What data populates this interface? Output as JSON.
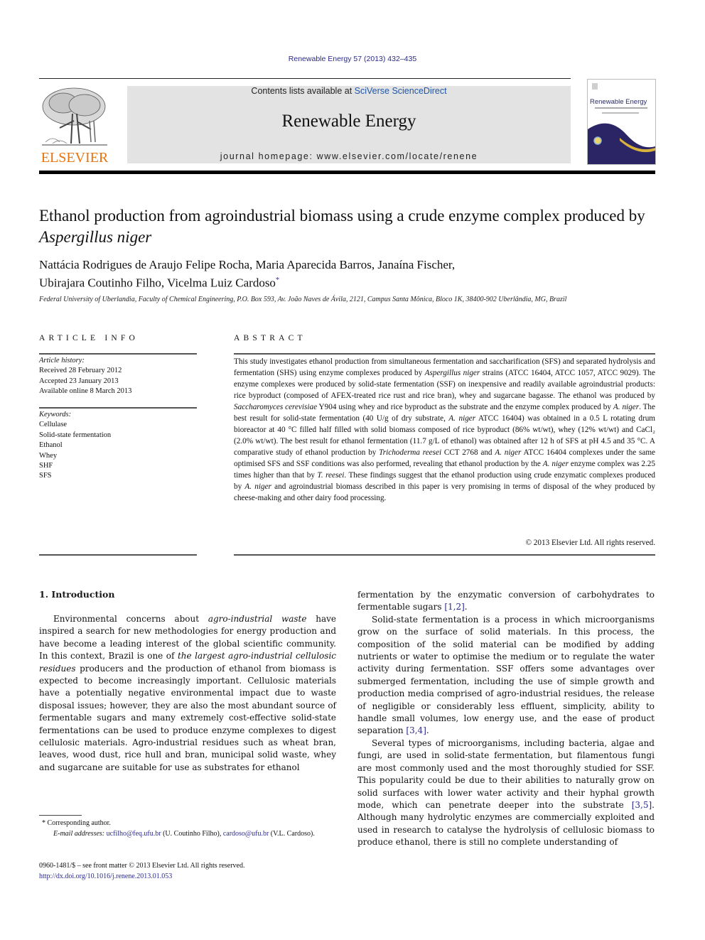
{
  "header": {
    "citation": "Renewable Energy 57 (2013) 432–435",
    "contents_prefix": "Contents lists available at ",
    "contents_link": "SciVerse ScienceDirect",
    "journal_name": "Renewable Energy",
    "homepage_prefix": "journal homepage: ",
    "homepage_url": "www.elsevier.com/locate/renene",
    "publisher_logo": "ELSEVIER",
    "cover_title": "Renewable Energy",
    "colors": {
      "link": "#2a2a8c",
      "elsevier_orange": "#e8730e",
      "masthead_gray": "#e3e3e3",
      "cover_navy": "#2b2566",
      "cover_gold": "#d8b23a"
    }
  },
  "article": {
    "title_plain": "Ethanol production from agroindustrial biomass using a crude enzyme complex produced by ",
    "title_italic": "Aspergillus niger",
    "authors_line1": "Nattácia Rodrigues de Araujo Felipe Rocha, Maria Aparecida Barros, Janaína Fischer,",
    "authors_line2": "Ubirajara Coutinho Filho, Vicelma Luiz Cardoso",
    "corresponding_mark": "*",
    "affiliation": "Federal University of Uberlandia, Faculty of Chemical Engineering, P.O. Box 593, Av. João Naves de Ávila, 2121, Campus Santa Mônica, Bloco 1K, 38400-902 Uberlândia, MG, Brazil"
  },
  "article_info": {
    "heading": "ARTICLE INFO",
    "history_label": "Article history:",
    "history": [
      "Received 28 February 2012",
      "Accepted 23 January 2013",
      "Available online 8 March 2013"
    ],
    "keywords_label": "Keywords:",
    "keywords": [
      "Cellulase",
      "Solid-state fermentation",
      "Ethanol",
      "Whey",
      "SHF",
      "SFS"
    ]
  },
  "abstract": {
    "heading": "ABSTRACT",
    "segments": [
      {
        "t": "This study investigates ethanol production from simultaneous fermentation and saccharification (SFS) and separated hydrolysis and fermentation (SHS) using enzyme complexes produced by "
      },
      {
        "i": "Aspergillus niger"
      },
      {
        "t": " strains (ATCC 16404, ATCC 1057, ATCC 9029). The enzyme complexes were produced by solid-state fermentation (SSF) on inexpensive and readily available agroindustrial products: rice byproduct (composed of AFEX-treated rice rust and rice bran), whey and sugarcane bagasse. The ethanol was produced by "
      },
      {
        "i": "Saccharomyces cerevisiae"
      },
      {
        "t": " Y904 using whey and rice byproduct as the substrate and the enzyme complex produced by "
      },
      {
        "i": "A. niger"
      },
      {
        "t": ". The best result for solid-state fermentation (40 U/g of dry substrate, "
      },
      {
        "i": "A. niger"
      },
      {
        "t": " ATCC 16404) was obtained in a 0.5 L rotating drum bioreactor at 40 °C filled half filled with solid biomass composed of rice byproduct (86% wt/wt), whey (12% wt/wt) and CaCl₂ (2.0% wt/wt). The best result for ethanol fermentation (11.7 g/L of ethanol) was obtained after 12 h of SFS at pH 4.5 and 35 °C. A comparative study of ethanol production by "
      },
      {
        "i": "Trichoderma reesei"
      },
      {
        "t": " CCT 2768 and "
      },
      {
        "i": "A. niger"
      },
      {
        "t": " ATCC 16404 complexes under the same optimised SFS and SSF conditions was also performed, revealing that ethanol production by the "
      },
      {
        "i": "A. niger"
      },
      {
        "t": " enzyme complex was 2.25 times higher than that by "
      },
      {
        "i": "T. reesei"
      },
      {
        "t": ". These findings suggest that the ethanol production using crude enzymatic complexes produced by "
      },
      {
        "i": "A. niger"
      },
      {
        "t": " and agroindustrial biomass described in this paper is very promising in terms of disposal of the whey produced by cheese-making and other dairy food processing."
      }
    ],
    "copyright": "© 2013 Elsevier Ltd. All rights reserved."
  },
  "introduction": {
    "heading": "1.  Introduction",
    "col1_segments": [
      {
        "t": "Environmental concerns about "
      },
      {
        "i": "agro-industrial waste"
      },
      {
        "t": " have inspired a search for new methodologies for energy production and have become a leading interest of the global scientific community. In this context, Brazil is one of "
      },
      {
        "i": "the largest agro-industrial cellulosic residues"
      },
      {
        "t": " producers and the production of ethanol from biomass is expected to become increasingly important. Cellulosic materials have a potentially negative environmental impact due to waste disposal issues; however, they are also the most abundant source of fermentable sugars and many extremely cost-effective solid-state fermentations can be used to produce enzyme complexes to digest cellulosic materials. Agro-industrial residues such as wheat bran, leaves, wood dust, rice hull and bran, municipal solid waste, whey and sugarcane are suitable for use as substrates for ethanol"
      }
    ],
    "col2_paragraphs": [
      {
        "indent": false,
        "segments": [
          {
            "t": "fermentation by the enzymatic conversion of carbohydrates to fermentable sugars "
          },
          {
            "r": "[1,2]"
          },
          {
            "t": "."
          }
        ]
      },
      {
        "indent": true,
        "segments": [
          {
            "t": "Solid-state fermentation is a process in which microorganisms grow on the surface of solid materials. In this process, the composition of the solid material can be modified by adding nutrients or water to optimise the medium or to regulate the water activity during fermentation. SSF offers some advantages over submerged fermentation, including the use of simple growth and production media comprised of agro-industrial residues, the release of negligible or considerably less effluent, simplicity, ability to handle small volumes, low energy use, and the ease of product separation "
          },
          {
            "r": "[3,4]"
          },
          {
            "t": "."
          }
        ]
      },
      {
        "indent": true,
        "segments": [
          {
            "t": "Several types of microorganisms, including bacteria, algae and fungi, are used in solid-state fermentation, but filamentous fungi are most commonly used and the most thoroughly studied for SSF. This popularity could be due to their abilities to naturally grow on solid surfaces with lower water activity and their hyphal growth mode, which can penetrate deeper into the substrate "
          },
          {
            "r": "[3,5]"
          },
          {
            "t": ". Although many hydrolytic enzymes are commercially exploited and used in research to catalyse the hydrolysis of cellulosic biomass to produce ethanol, there is still no complete understanding of"
          }
        ]
      }
    ]
  },
  "footnotes": {
    "corresponding": "* Corresponding author.",
    "email_label": "E-mail addresses:",
    "email1": "ucfilho@feq.ufu.br",
    "email1_owner": " (U. Coutinho Filho), ",
    "email2": "cardoso@ufu.br",
    "email2_owner": " (V.L. Cardoso).",
    "front_matter": "0960-1481/$ – see front matter © 2013 Elsevier Ltd. All rights reserved.",
    "doi": "http://dx.doi.org/10.1016/j.renene.2013.01.053"
  }
}
